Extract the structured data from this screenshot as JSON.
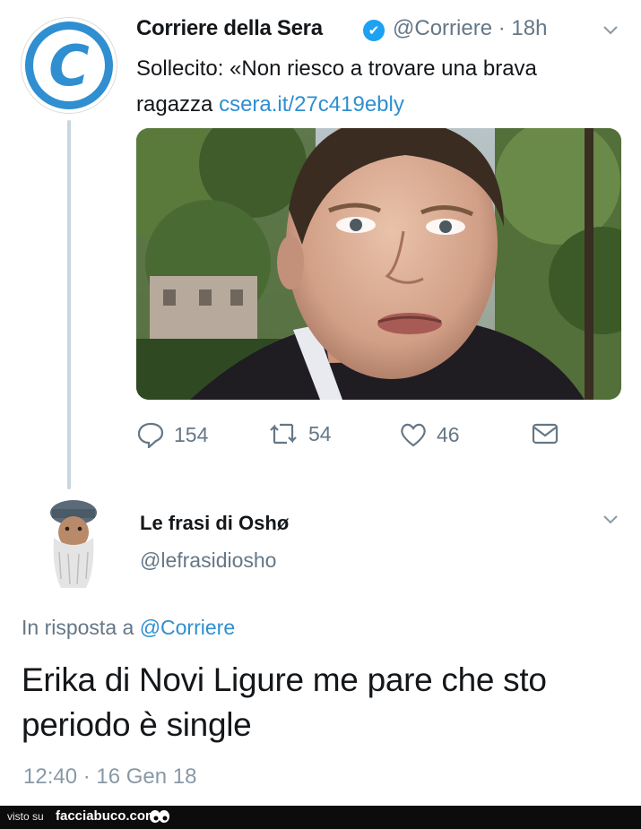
{
  "tweet": {
    "author_name": "Corriere della Sera",
    "handle_time": "@Corriere · 18h",
    "verified_mark": "✔",
    "avatar_letter": "C",
    "text": "Sollecito: «Non riesco a trovare una brava ragazza",
    "link": "csera.it/27c419ebly",
    "actions": {
      "replies": "154",
      "retweets": "54",
      "likes": "46"
    }
  },
  "reply": {
    "author_name": "Le frasi di Oshø",
    "handle": "@lefrasidiosho",
    "reply_prefix": "In risposta a",
    "reply_to": "@Corriere",
    "text": "Erika di Novi Ligure me pare che sto periodo è single",
    "timestamp": "12:40 · 16 Gen 18"
  },
  "footer": {
    "visto": "visto su",
    "brand": "facciabuco.com"
  },
  "icons": [
    "reply-icon",
    "retweet-icon",
    "like-icon",
    "dm-icon",
    "chevron-down-icon",
    "verified-icon"
  ],
  "colors": {
    "link": "#2f8fd0",
    "muted": "#657786",
    "brand_blue": "#2f8fd0",
    "verified": "#1da1f2"
  }
}
